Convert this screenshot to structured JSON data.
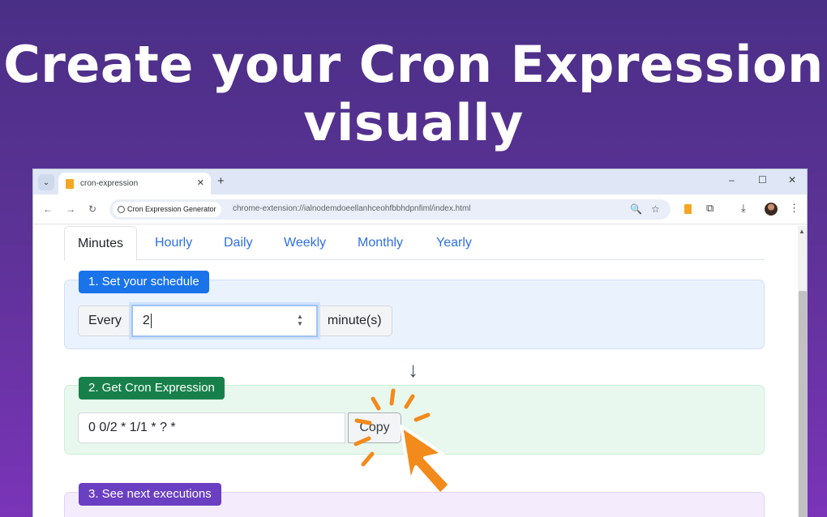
{
  "headline": {
    "line1": "Create your Cron Expression",
    "line2": "visually"
  },
  "browser": {
    "tab_title": "cron-expression",
    "tab_close": "✕",
    "new_tab": "+",
    "window_controls": {
      "minimize": "–",
      "maximize": "☐",
      "close": "✕"
    },
    "nav": {
      "back": "←",
      "forward": "→",
      "reload": "↻"
    },
    "site_chip": "Cron Expression Generator",
    "url": "chrome-extension://ialnodemdoeellanhceohfbbhdpnfiml/index.html",
    "toolbar_icons": {
      "zoom": "🔍",
      "bookmark": "☆",
      "extensions": "⧉",
      "download": "⤓",
      "menu": "⋮"
    }
  },
  "app": {
    "tabs": [
      {
        "label": "Minutes",
        "active": true
      },
      {
        "label": "Hourly"
      },
      {
        "label": "Daily"
      },
      {
        "label": "Weekly"
      },
      {
        "label": "Monthly"
      },
      {
        "label": "Yearly"
      }
    ],
    "step1": {
      "badge": "1. Set your schedule",
      "prefix": "Every",
      "value": "2",
      "suffix": "minute(s)"
    },
    "arrow": "↓",
    "step2": {
      "badge": "2. Get Cron Expression",
      "expression": "0 0/2 * 1/1 * ? *",
      "copy_label": "Copy"
    },
    "step3": {
      "badge": "3. See next executions"
    }
  },
  "colors": {
    "accent_blue": "#1973ea",
    "accent_green": "#17804a",
    "accent_purple": "#6b3fc2",
    "cursor_orange": "#f28a1c"
  }
}
